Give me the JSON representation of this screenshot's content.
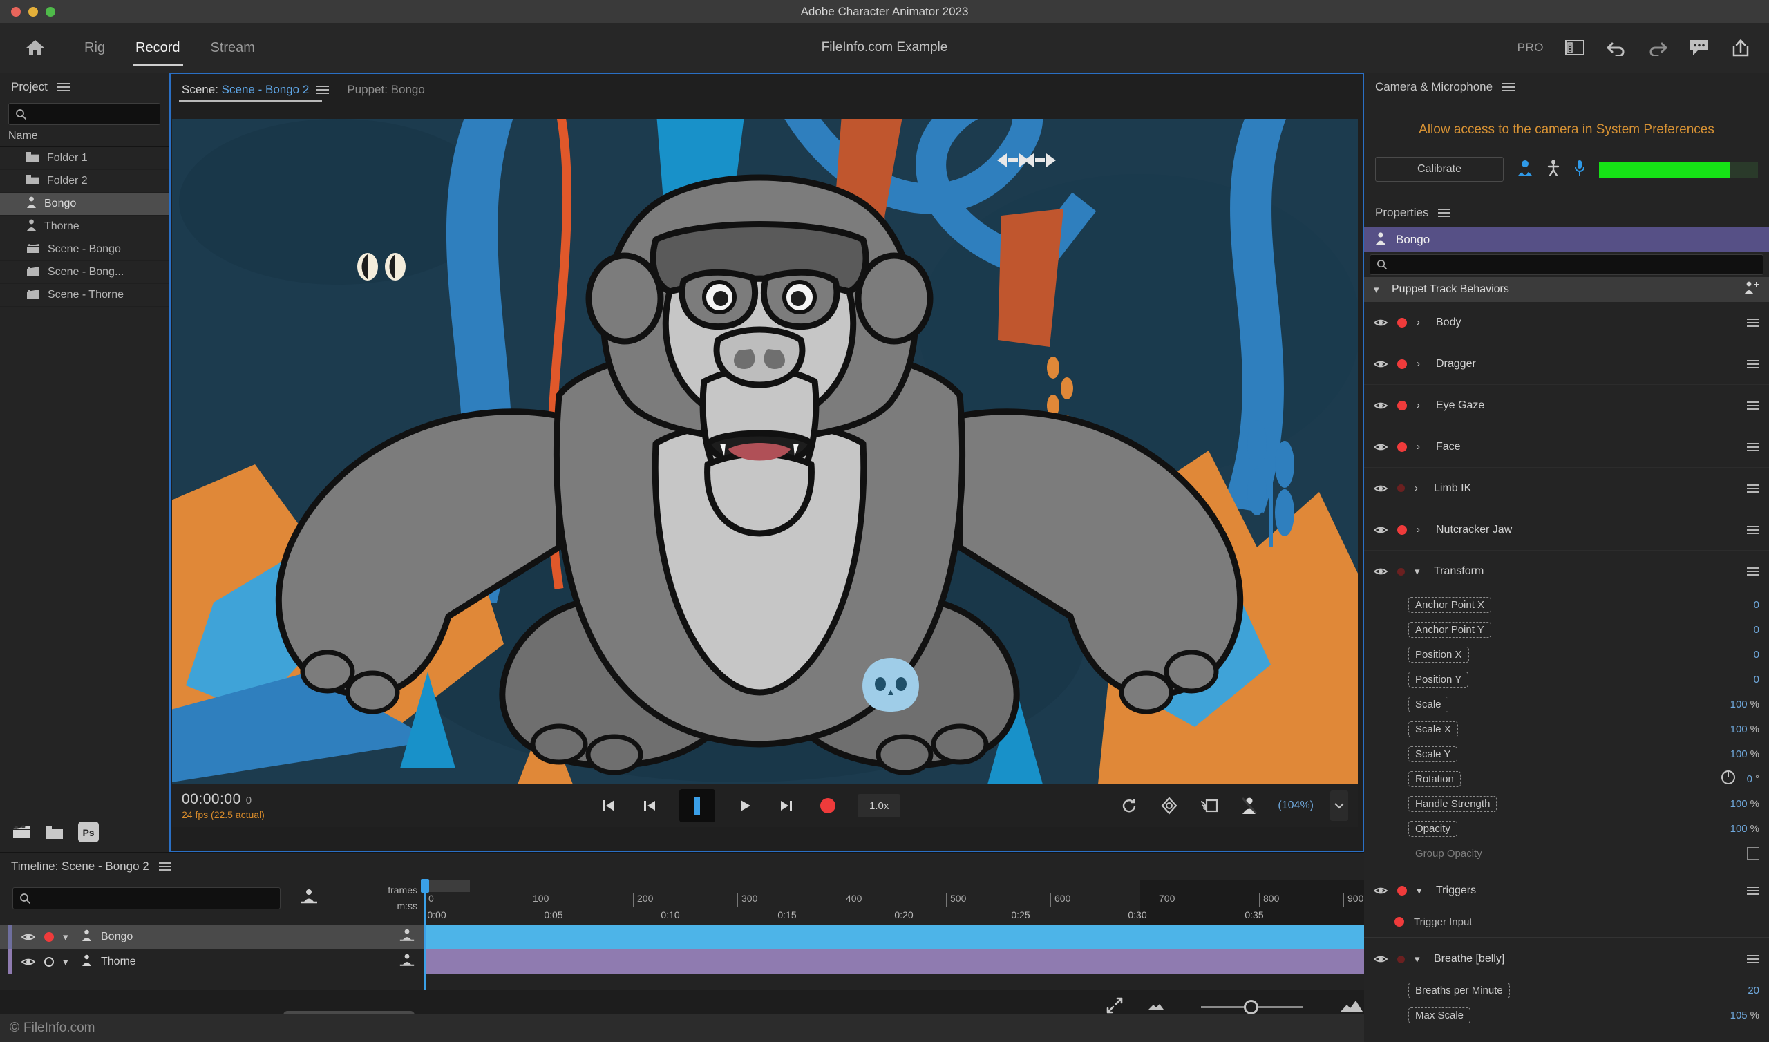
{
  "window": {
    "title": "Adobe Character Animator 2023"
  },
  "topbar": {
    "home_icon": "home-icon",
    "nav": [
      {
        "label": "Rig",
        "active": false
      },
      {
        "label": "Record",
        "active": true
      },
      {
        "label": "Stream",
        "active": false
      }
    ],
    "document_title": "FileInfo.com Example",
    "pro_label": "PRO",
    "icons": [
      "workspace-icon",
      "undo-icon",
      "redo-icon",
      "comment-icon",
      "share-icon"
    ]
  },
  "project": {
    "title": "Project",
    "menu_icon": "hamburger-icon",
    "search_placeholder": "",
    "search_value": "",
    "column_header": "Name",
    "items": [
      {
        "label": "Folder 1",
        "icon": "folder-icon",
        "selected": false
      },
      {
        "label": "Folder 2",
        "icon": "folder-icon",
        "selected": false
      },
      {
        "label": "Bongo",
        "icon": "puppet-icon",
        "selected": true
      },
      {
        "label": "Thorne",
        "icon": "puppet-icon",
        "selected": false
      },
      {
        "label": "Scene - Bongo",
        "icon": "scene-icon",
        "selected": false
      },
      {
        "label": "Scene - Bong...",
        "icon": "scene-icon",
        "selected": false
      },
      {
        "label": "Scene - Thorne",
        "icon": "scene-icon",
        "selected": false
      }
    ],
    "footer_icons": [
      "new-scene-icon",
      "new-folder-icon",
      "photoshop-icon"
    ]
  },
  "scene": {
    "tabs": [
      {
        "prefix": "Scene:",
        "name": "Scene - Bongo 2",
        "active": true,
        "menu_icon": "hamburger-icon"
      },
      {
        "prefix": "Puppet:",
        "name": "Bongo",
        "active": false
      }
    ]
  },
  "transport": {
    "timecode": "00:00:00",
    "frame": "0",
    "fps": "24 fps (22.5 actual)",
    "buttons": [
      {
        "name": "go-to-start-button",
        "icon": "skip-start-icon"
      },
      {
        "name": "step-back-button",
        "icon": "step-back-icon"
      },
      {
        "name": "stop-button",
        "icon": "stop-icon"
      },
      {
        "name": "play-button",
        "icon": "play-icon"
      },
      {
        "name": "step-forward-button",
        "icon": "step-forward-icon"
      },
      {
        "name": "record-button",
        "icon": "record-icon"
      }
    ],
    "speed": "1.0x",
    "right_icons": [
      "refresh-icon",
      "color-icon",
      "broadcast-icon",
      "puppet-overlay-icon"
    ],
    "zoom_level": "(104%)"
  },
  "camera": {
    "title": "Camera & Microphone",
    "menu_icon": "hamburger-icon",
    "warning": "Allow access to the camera in System Preferences",
    "calibrate_label": "Calibrate",
    "toggle_icons": [
      "camera-icon",
      "body-tracker-icon",
      "microphone-icon"
    ],
    "meter_percent": 82,
    "meter_color": "#16e216"
  },
  "properties": {
    "title": "Properties",
    "menu_icon": "hamburger-icon",
    "puppet_name": "Bongo",
    "puppet_icon": "puppet-icon",
    "search_value": "",
    "group": {
      "label": "Puppet Track Behaviors",
      "add_icon": "add-behavior-icon",
      "expanded": true
    },
    "behaviors": [
      {
        "label": "Body",
        "expanded": false,
        "armed": true
      },
      {
        "label": "Dragger",
        "expanded": false,
        "armed": true
      },
      {
        "label": "Eye Gaze",
        "expanded": false,
        "armed": true
      },
      {
        "label": "Face",
        "expanded": false,
        "armed": true
      },
      {
        "label": "Limb IK",
        "expanded": false,
        "armed": false
      },
      {
        "label": "Nutcracker Jaw",
        "expanded": false,
        "armed": true
      },
      {
        "label": "Transform",
        "expanded": true,
        "armed": false
      }
    ],
    "transform_params": [
      {
        "label": "Anchor Point X",
        "value": "0",
        "unit": ""
      },
      {
        "label": "Anchor Point Y",
        "value": "0",
        "unit": ""
      },
      {
        "label": "Position X",
        "value": "0",
        "unit": ""
      },
      {
        "label": "Position Y",
        "value": "0",
        "unit": ""
      },
      {
        "label": "Scale",
        "value": "100",
        "unit": "%"
      },
      {
        "label": "Scale X",
        "value": "100",
        "unit": "%"
      },
      {
        "label": "Scale Y",
        "value": "100",
        "unit": "%"
      },
      {
        "label": "Rotation",
        "value": "0",
        "unit": "°"
      },
      {
        "label": "Handle Strength",
        "value": "100",
        "unit": "%"
      },
      {
        "label": "Opacity",
        "value": "100",
        "unit": "%"
      }
    ],
    "group_opacity_label": "Group Opacity",
    "triggers": {
      "label": "Triggers",
      "armed": true,
      "input_label": "Trigger Input"
    },
    "breathe": {
      "label": "Breathe [belly]",
      "armed": false,
      "params": [
        {
          "label": "Breaths per Minute",
          "value": "20",
          "unit": ""
        },
        {
          "label": "Max Scale",
          "value": "105",
          "unit": "%"
        }
      ]
    }
  },
  "timeline": {
    "title": "Timeline: Scene - Bongo 2",
    "menu_icon": "hamburger-icon",
    "search_value": "",
    "pin_icon": "puppet-pin-icon",
    "row_labels": {
      "frames": "frames",
      "mss": "m:ss"
    },
    "frame_ticks": [
      "0",
      "100",
      "200",
      "300",
      "400",
      "500",
      "600",
      "700",
      "800",
      "900"
    ],
    "time_ticks": [
      "0:00",
      "0:05",
      "0:10",
      "0:15",
      "0:20",
      "0:25",
      "0:30",
      "0:35"
    ],
    "tracks": [
      {
        "name": "Bongo",
        "armed": true,
        "selected": true,
        "clip_color": "#4db4e8",
        "icon": "puppet-icon"
      },
      {
        "name": "Thorne",
        "armed": false,
        "selected": false,
        "clip_color": "#8f7bb0",
        "icon": "puppet-icon"
      }
    ],
    "zoom_icons": [
      "fit-icon",
      "zoom-out-icon",
      "zoom-in-icon"
    ],
    "zoom_value": 42
  },
  "status": {
    "text": "FileInfo.com",
    "copyright": "©"
  }
}
